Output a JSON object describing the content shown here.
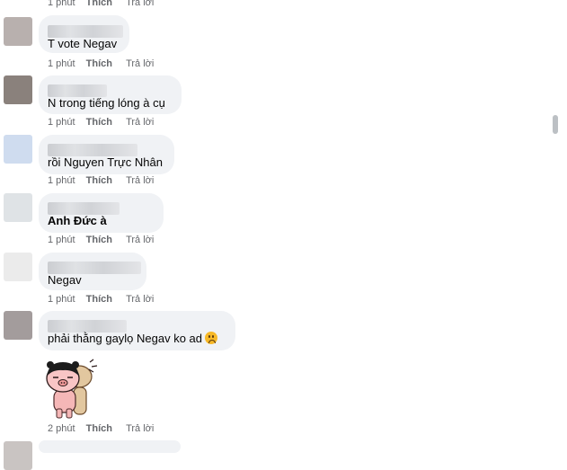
{
  "comments": [
    {
      "name": "Van Tat N",
      "text": "T vote Negav",
      "time": "1 phút",
      "like": "Thích",
      "reply": "Trả lời",
      "avatar_color": "#b8b0ae"
    },
    {
      "name": "Tô M N",
      "text": "N trong tiếng lóng à cụ",
      "time": "1 phút",
      "like": "Thích",
      "reply": "Trả lời",
      "avatar_color": "#8a817c"
    },
    {
      "name": "Nguyễn Quang Đạt",
      "text": "rồi Nguyen Trực Nhân",
      "time": "1 phút",
      "like": "Thích",
      "reply": "Trả lời",
      "avatar_color": "#cfdcef"
    },
    {
      "name": "Tô Ngọc Hải",
      "tag": "Anh Đức",
      "text": "Anh Đức à",
      "time": "1 phút",
      "like": "Thích",
      "reply": "Trả lời",
      "avatar_color": "#dfe3e6"
    },
    {
      "name": "Nguyen Thanh Đạt",
      "text": "Negav",
      "time": "1 phút",
      "like": "Thích",
      "reply": "Trả lời",
      "avatar_color": "#e8e8e8"
    },
    {
      "name": "Trương Chí",
      "text": "phải thằng gaylọ Negav ko ad",
      "emoji": "worried-face",
      "time": "2 phút",
      "like": "Thích",
      "reply": "Trả lời",
      "avatar_color": "#a39c9c"
    }
  ],
  "top_partial": {
    "time": "1 phút",
    "like": "Thích",
    "reply": "Trả lời"
  },
  "sticker": "pig-sticker"
}
